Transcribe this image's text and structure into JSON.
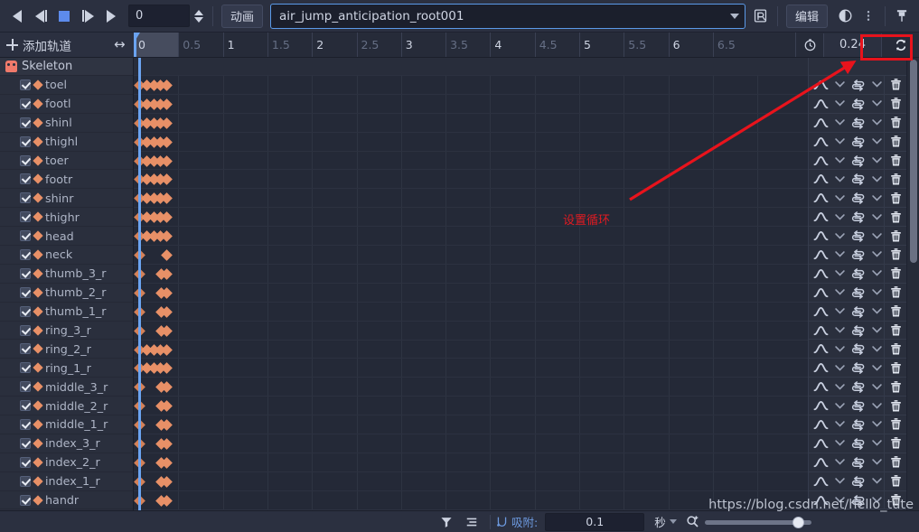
{
  "toolbar": {
    "transport": [
      {
        "name": "play-backward-button",
        "icon": "play-backward-icon"
      },
      {
        "name": "step-backward-button",
        "icon": "step-backward-icon"
      },
      {
        "name": "stop-button",
        "icon": "stop-icon"
      },
      {
        "name": "step-forward-button",
        "icon": "step-forward-icon"
      },
      {
        "name": "play-forward-button",
        "icon": "play-forward-icon"
      }
    ],
    "frame_value": "0",
    "animation_label": "动画",
    "animation_name": "air_jump_anticipation_root001",
    "edit_label": "编辑",
    "icons": {
      "save_animation": "save-animation-icon",
      "onion_skin": "onion-skin-icon",
      "more_options": "more-options-icon",
      "pin": "pin-icon"
    }
  },
  "ruler": {
    "add_track_label": "添加轨道",
    "resize_icon": "horizontal-resize-icon",
    "ticks": [
      {
        "label": "0",
        "major": true
      },
      {
        "label": "0.5",
        "major": false
      },
      {
        "label": "1",
        "major": true
      },
      {
        "label": "1.5",
        "major": false
      },
      {
        "label": "2",
        "major": true
      },
      {
        "label": "2.5",
        "major": false
      },
      {
        "label": "3",
        "major": true
      },
      {
        "label": "3.5",
        "major": false
      },
      {
        "label": "4",
        "major": true
      },
      {
        "label": "4.5",
        "major": false
      },
      {
        "label": "5",
        "major": true
      },
      {
        "label": "5.5",
        "major": false
      },
      {
        "label": "6",
        "major": true
      },
      {
        "label": "6.5",
        "major": false
      }
    ],
    "timer_icon": "stopwatch-icon",
    "length_value": "0.24",
    "loop_icon": "loop-icon"
  },
  "tracks": {
    "group_label": "Skeleton",
    "group_icon": "skeleton-icon",
    "rows": [
      {
        "label": "toel",
        "checked": true,
        "pattern": "full"
      },
      {
        "label": "footl",
        "checked": true,
        "pattern": "full"
      },
      {
        "label": "shinl",
        "checked": true,
        "pattern": "full"
      },
      {
        "label": "thighl",
        "checked": true,
        "pattern": "full"
      },
      {
        "label": "toer",
        "checked": true,
        "pattern": "full"
      },
      {
        "label": "footr",
        "checked": true,
        "pattern": "full"
      },
      {
        "label": "shinr",
        "checked": true,
        "pattern": "full"
      },
      {
        "label": "thighr",
        "checked": true,
        "pattern": "full"
      },
      {
        "label": "head",
        "checked": true,
        "pattern": "full"
      },
      {
        "label": "neck",
        "checked": true,
        "pattern": "single"
      },
      {
        "label": "thumb_3_r",
        "checked": true,
        "pattern": "pair"
      },
      {
        "label": "thumb_2_r",
        "checked": true,
        "pattern": "pair"
      },
      {
        "label": "thumb_1_r",
        "checked": true,
        "pattern": "pair"
      },
      {
        "label": "ring_3_r",
        "checked": true,
        "pattern": "pair"
      },
      {
        "label": "ring_2_r",
        "checked": true,
        "pattern": "full"
      },
      {
        "label": "ring_1_r",
        "checked": true,
        "pattern": "full"
      },
      {
        "label": "middle_3_r",
        "checked": true,
        "pattern": "pair"
      },
      {
        "label": "middle_2_r",
        "checked": true,
        "pattern": "pair"
      },
      {
        "label": "middle_1_r",
        "checked": true,
        "pattern": "pair"
      },
      {
        "label": "index_3_r",
        "checked": true,
        "pattern": "pair"
      },
      {
        "label": "index_2_r",
        "checked": true,
        "pattern": "pair"
      },
      {
        "label": "index_1_r",
        "checked": true,
        "pattern": "pair"
      },
      {
        "label": "handr",
        "checked": true,
        "pattern": "pair"
      }
    ],
    "row_controls": {
      "interpolation_icon": "curve-interpolation-icon",
      "interpolation_chevron": "chevron-down-icon",
      "wrap_icon": "loop-wrap-icon",
      "wrap_chevron": "chevron-down-icon",
      "delete_icon": "trash-icon"
    }
  },
  "bottom": {
    "filter_icon": "filter-icon",
    "list_icon": "list-icon",
    "snap_icon": "snap-icon",
    "snap_label": "吸附:",
    "snap_value": "0.1",
    "unit_value": "秒",
    "zoom_icon": "zoom-icon"
  },
  "annotations": {
    "callout_text": "设置循环",
    "arrow_color": "#e8131c",
    "box_color": "#e8131c"
  },
  "watermark": "https://blog.csdn.net/hello_tute",
  "colors": {
    "accent_blue": "#5b9ae8",
    "keyframe_orange": "#e89067",
    "panel_bg": "#2b3040",
    "grid_bg": "#242937",
    "annotation_red": "#e8131c"
  }
}
